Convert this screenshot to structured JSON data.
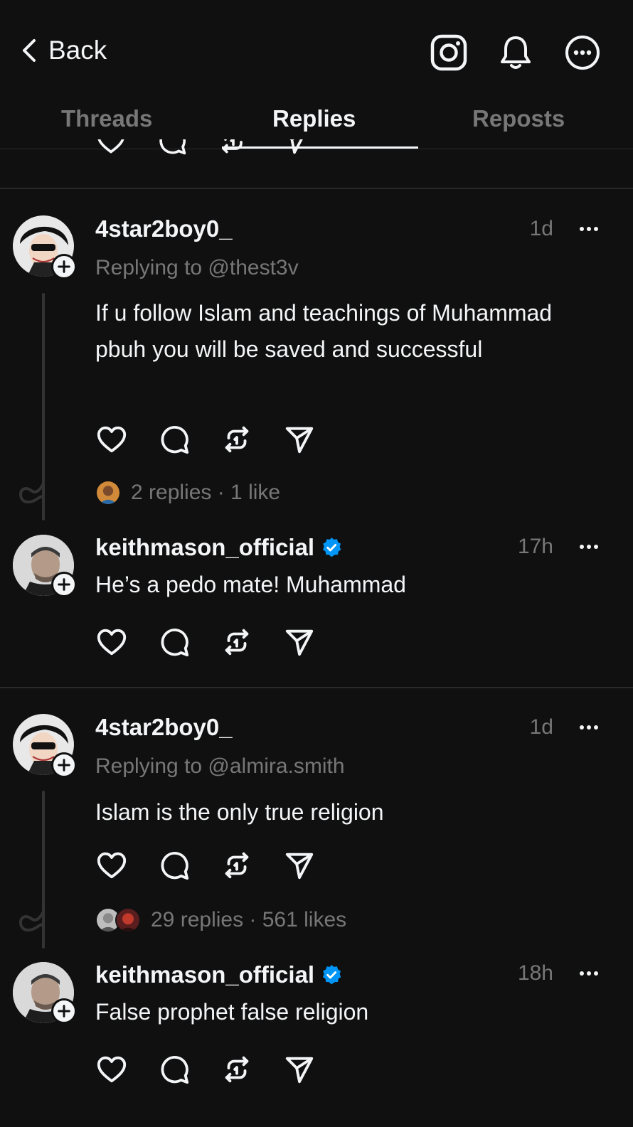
{
  "header": {
    "back_label": "Back"
  },
  "tabs": [
    {
      "label": "Threads",
      "active": false
    },
    {
      "label": "Replies",
      "active": true
    },
    {
      "label": "Reposts",
      "active": false
    }
  ],
  "posts": [
    {
      "username": "4star2boy0_",
      "verified": false,
      "time": "1d",
      "replying_to": "Replying to @thest3v",
      "text": "If u follow Islam and teachings of Muhammad pbuh you will be saved and successful",
      "stats": "2 replies · 1 like"
    },
    {
      "username": "keithmason_official",
      "verified": true,
      "time": "17h",
      "text": "He’s a pedo mate! Muhammad"
    },
    {
      "username": "4star2boy0_",
      "verified": false,
      "time": "1d",
      "replying_to": "Replying to @almira.smith",
      "text": "Islam is the only true religion",
      "stats": "29 replies · 561 likes"
    },
    {
      "username": "keithmason_official",
      "verified": true,
      "time": "18h",
      "text": "False prophet false religion"
    }
  ],
  "colors": {
    "background": "#101010",
    "text": "#f3f5f7",
    "muted": "#777777",
    "verified": "#0095f6"
  },
  "icons": [
    "chevron-left-icon",
    "instagram-icon",
    "bell-icon",
    "more-circle-icon",
    "heart-icon",
    "comment-icon",
    "repost-icon",
    "share-icon",
    "plus-icon",
    "verified-badge-icon"
  ]
}
